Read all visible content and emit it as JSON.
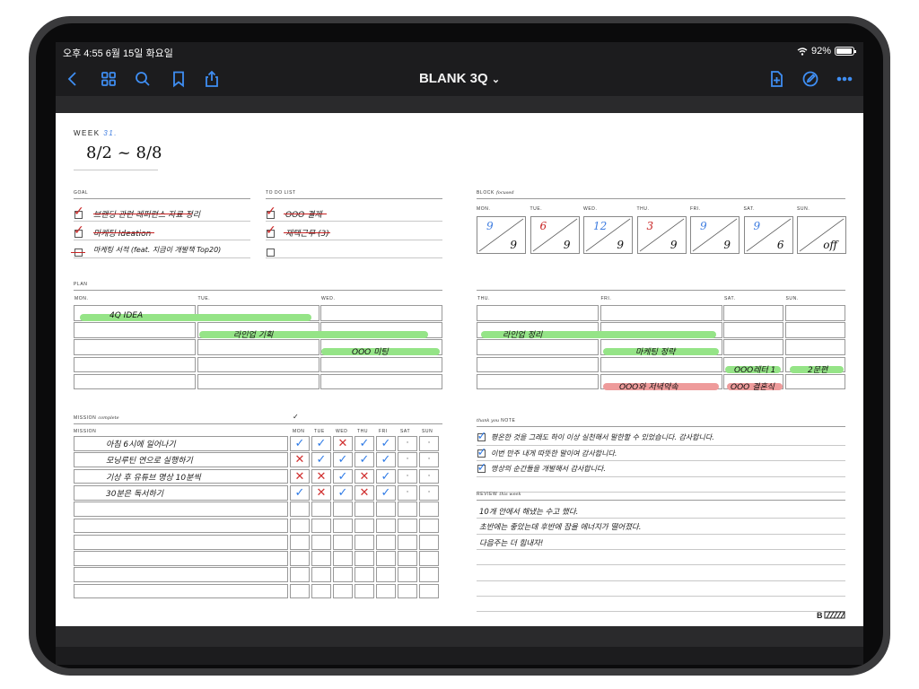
{
  "status": {
    "time": "오후 4:55  6월 15일 화요일",
    "battery": "92%"
  },
  "toolbar": {
    "title": "BLANK 3Q",
    "title_chevron": "⌄"
  },
  "week": {
    "label": "WEEK",
    "number": "31.",
    "range": "8/2 ~ 8/8"
  },
  "goal": {
    "label": "GOAL",
    "items": [
      {
        "text": "브랜딩 관련 레퍼런스 자료 정리",
        "done": true
      },
      {
        "text": "마케팅 Ideation",
        "done": true
      },
      {
        "text": "마케팅 서적 (feat. 지금이 개발책 Top20)",
        "done": false
      }
    ]
  },
  "todo": {
    "label": "TO DO LIST",
    "items": [
      {
        "text": "OOO 결제",
        "done": true
      },
      {
        "text": "재택근무 (3)",
        "done": true
      },
      {
        "text": "",
        "done": false
      }
    ]
  },
  "block": {
    "label": "BLOCK",
    "label_sub": "focused",
    "days": [
      {
        "name": "MON.",
        "top": "9",
        "bottom": "9",
        "top_color": "#3f7de0"
      },
      {
        "name": "TUE.",
        "top": "6",
        "bottom": "9",
        "top_color": "#c82323"
      },
      {
        "name": "WED.",
        "top": "12",
        "bottom": "9",
        "top_color": "#3f7de0"
      },
      {
        "name": "THU.",
        "top": "3",
        "bottom": "9",
        "top_color": "#c82323"
      },
      {
        "name": "FRI.",
        "top": "9",
        "bottom": "9",
        "top_color": "#3f7de0"
      },
      {
        "name": "SAT.",
        "top": "9",
        "bottom": "6",
        "top_color": "#3f7de0"
      },
      {
        "name": "SUN.",
        "top": "",
        "bottom": "off",
        "top_color": "#111111"
      }
    ]
  },
  "plan": {
    "label": "PLAN",
    "left_days": [
      "MON.",
      "TUE.",
      "WED."
    ],
    "right_days": [
      "THU.",
      "FRI.",
      "SAT.",
      "SUN."
    ],
    "entries": [
      {
        "text": "4Q IDEA",
        "color": "green"
      },
      {
        "text": "라인업 기획",
        "color": "green"
      },
      {
        "text": "OOO 미팅",
        "color": "green"
      },
      {
        "text": "라인업 정리",
        "color": "green"
      },
      {
        "text": "마케팅 정략",
        "color": "green"
      },
      {
        "text": "OOO레터 1",
        "color": "green"
      },
      {
        "text": "2문편",
        "color": "green"
      },
      {
        "text": "OOO와 저녁약속",
        "color": "red"
      },
      {
        "text": "OOO 결혼식",
        "color": "red"
      }
    ]
  },
  "mission": {
    "label": "MISSION",
    "label_sub": "complete",
    "header_check": "✓",
    "col_label": "MISSION",
    "days": [
      "MON",
      "TUE",
      "WED",
      "THU",
      "FRI",
      "SAT",
      "SUN"
    ],
    "rows": [
      {
        "text": "아침 6시에 일어나기",
        "marks": [
          "v",
          "v",
          "x",
          "v",
          "v",
          "·",
          "·"
        ]
      },
      {
        "text": "모닝루틴 연으로 실행하기",
        "marks": [
          "x",
          "v",
          "v",
          "v",
          "v",
          "·",
          "·"
        ]
      },
      {
        "text": "기상 후 유튜브 명상 10분씩",
        "marks": [
          "x",
          "x",
          "v",
          "x",
          "v",
          "·",
          "·"
        ]
      },
      {
        "text": "30분은 독서하기",
        "marks": [
          "v",
          "x",
          "v",
          "x",
          "v",
          "·",
          "·"
        ]
      }
    ]
  },
  "thanks": {
    "label": "NOTE",
    "label_pre": "thank you",
    "items": [
      "평온한 것을 그래도 하이 이상 실천해서 말한할 수 있었습니다. 감사합니다.",
      "이번 만주 내게 따뜻한 말이여 감사합니다.",
      "명상의 순간들을 개발해서 감사합니다."
    ]
  },
  "review": {
    "label": "REVIEW",
    "label_sub": "this week",
    "lines": [
      "10개 안에서 해냈는 수고 했다.",
      "초반에는 좋았는데 후반에 잠을 에너지가 떨어졌다.",
      "다음주는 더 힘내자!"
    ]
  },
  "colors": {
    "accent": "#3f8ef3",
    "check_blue": "#2f7be6",
    "x_red": "#d03030",
    "highlight_green": "#95e487",
    "highlight_red": "#ee9b9b"
  }
}
